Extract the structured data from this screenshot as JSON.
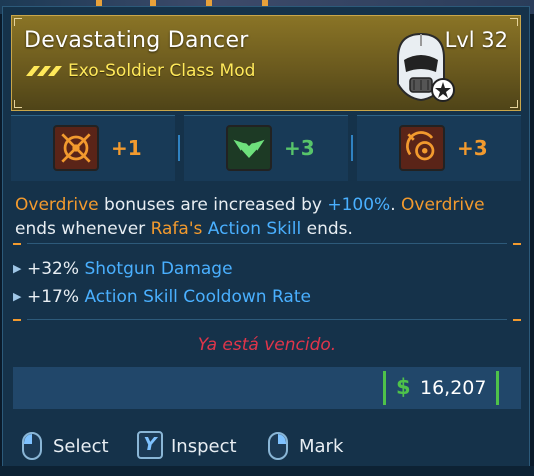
{
  "item": {
    "name": "Devastating Dancer",
    "level": "Lvl 32",
    "subtitle": "Exo-Soldier Class Mod",
    "rarity_color": "#ffe95a",
    "class_icon": "exo-soldier-helmet-icon"
  },
  "skills": [
    {
      "icon": "bullseye-crosshair-skill-icon",
      "bonus": "+1",
      "color": "#f29a2e"
    },
    {
      "icon": "green-heart-wings-skill-icon",
      "bonus": "+3",
      "color": "#57c46a"
    },
    {
      "icon": "orange-target-arc-skill-icon",
      "bonus": "+3",
      "color": "#f29a2e"
    }
  ],
  "description": {
    "l1a": "Overdrive",
    "l1b": " bonuses are increased by ",
    "l1c": "+100%",
    "l1d": ". ",
    "l1e": "Overdrive",
    "l2a": "ends whenever ",
    "l2b": "Rafa's",
    "l2c": " ",
    "l2d": "Action Skill",
    "l2e": " ends."
  },
  "stats": [
    {
      "value": "+32%",
      "label": "Shotgun Damage"
    },
    {
      "value": "+17%",
      "label": "Action Skill Cooldown Rate"
    }
  ],
  "warning": "Ya está vencido.",
  "price": {
    "symbol": "$",
    "value": "16,207",
    "color": "#4ec24a"
  },
  "controls": [
    {
      "icon": "mouse-left-click-icon",
      "label": "Select"
    },
    {
      "icon": "y-key-icon",
      "key": "Y",
      "label": "Inspect"
    },
    {
      "icon": "mouse-right-click-icon",
      "label": "Mark"
    }
  ]
}
